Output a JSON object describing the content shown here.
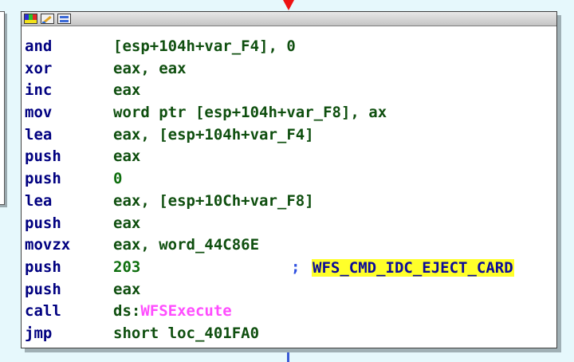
{
  "background": {
    "left_node_char": "0",
    "edge_color": "#3a5bd6",
    "arrow_color": "#ee1111"
  },
  "node": {
    "toolbar_icons": [
      "palette-icon",
      "pencil-icon",
      "graph-icon"
    ],
    "colors": {
      "mnemonic": "#000080",
      "operand": "#0f4f0f",
      "import": "#ff4dff",
      "comment": "#2d4fe0",
      "highlight": "#ffff2a"
    },
    "lines": [
      {
        "mnemonic": "and",
        "operand": "[esp+104h+var_F4], 0"
      },
      {
        "mnemonic": "xor",
        "operand": "eax, eax"
      },
      {
        "mnemonic": "inc",
        "operand": "eax"
      },
      {
        "mnemonic": "mov",
        "operand": "word ptr [esp+104h+var_F8], ax"
      },
      {
        "mnemonic": "lea",
        "operand": "eax, [esp+104h+var_F4]"
      },
      {
        "mnemonic": "push",
        "operand": "eax"
      },
      {
        "mnemonic": "push",
        "operand": "0"
      },
      {
        "mnemonic": "lea",
        "operand": "eax, [esp+10Ch+var_F8]"
      },
      {
        "mnemonic": "push",
        "operand": "eax"
      },
      {
        "mnemonic": "movzx",
        "operand": "eax, word_44C86E"
      },
      {
        "mnemonic": "push",
        "operand": "203",
        "comment_marker": ";",
        "comment": "WFS_CMD_IDC_EJECT_CARD"
      },
      {
        "mnemonic": "push",
        "operand": "eax"
      },
      {
        "mnemonic": "call",
        "operand_prefix": "ds:",
        "operand_import": "WFSExecute"
      },
      {
        "mnemonic": "jmp",
        "operand": "short loc_401FA0"
      }
    ]
  }
}
